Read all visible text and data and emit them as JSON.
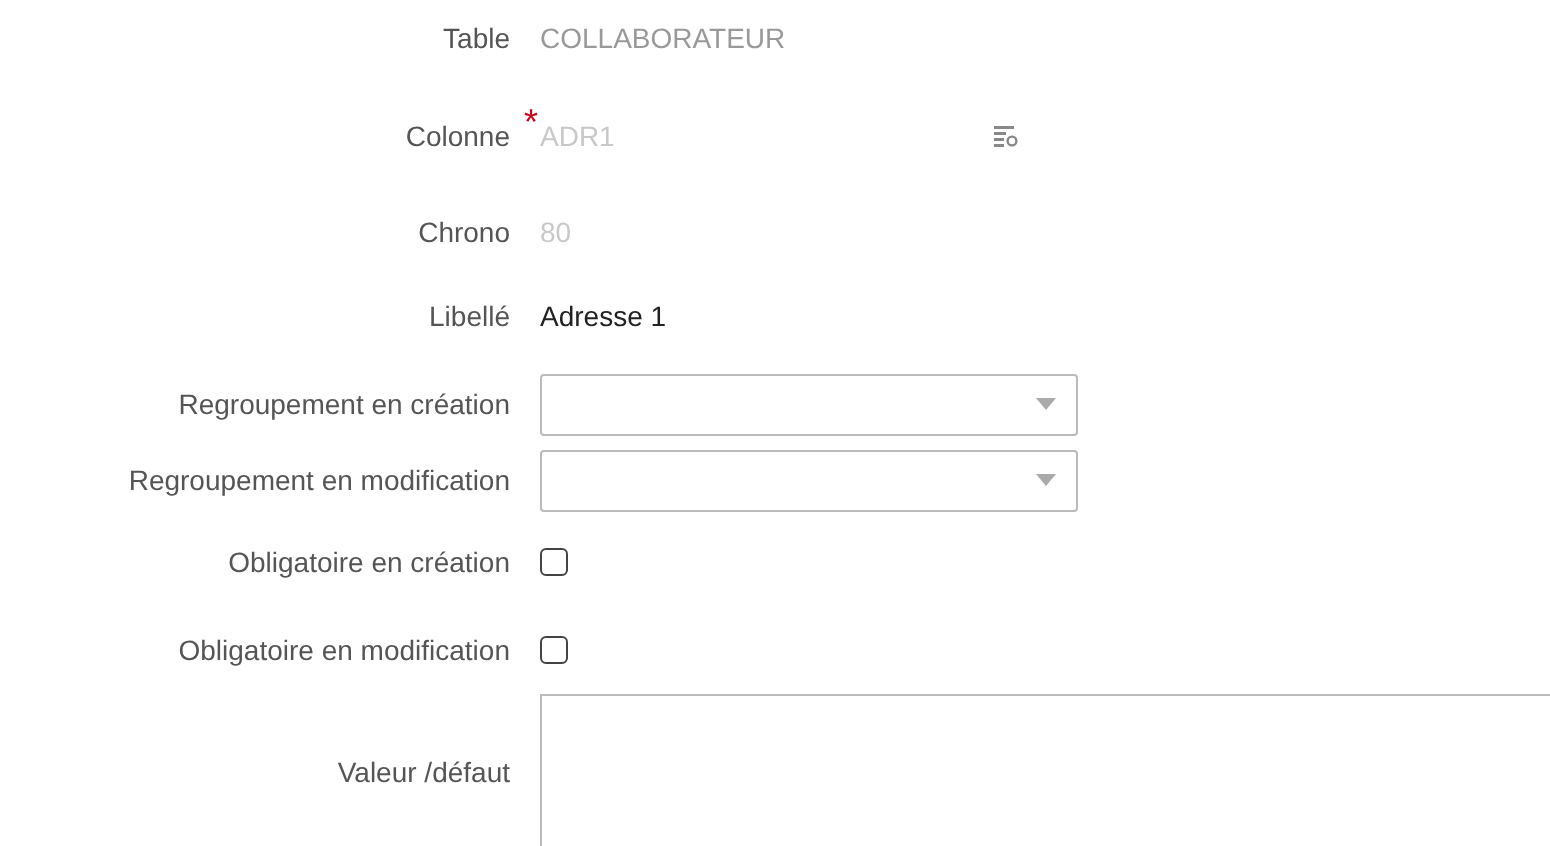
{
  "fields": [
    {
      "label": "Table",
      "kind": "static",
      "value": "COLLABORATEUR"
    },
    {
      "label": "Colonne",
      "kind": "lookup",
      "required_mark": "*",
      "disabled": true,
      "value": "ADR1"
    },
    {
      "label": "Chrono",
      "kind": "text",
      "disabled": true,
      "value": "80"
    },
    {
      "label": "Libellé",
      "kind": "text",
      "disabled": false,
      "value": "Adresse 1"
    },
    {
      "label": "Regroupement en création",
      "kind": "select"
    },
    {
      "label": "Regroupement en modification",
      "kind": "select"
    },
    {
      "label": "Obligatoire en création",
      "kind": "checkbox",
      "checked": false
    },
    {
      "label": "Obligatoire en modification",
      "kind": "checkbox",
      "checked": false
    },
    {
      "label": "Valeur /défaut",
      "kind": "textarea"
    }
  ]
}
